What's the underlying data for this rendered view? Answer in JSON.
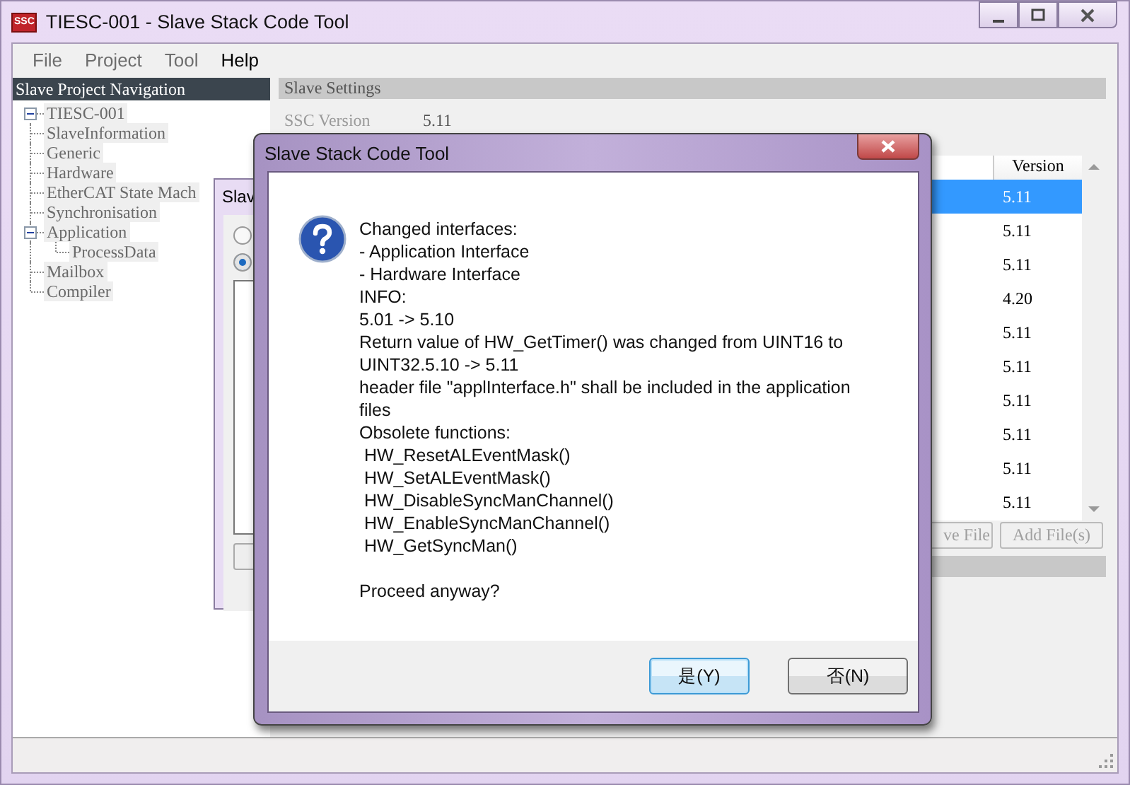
{
  "window": {
    "title": "TIESC-001 - Slave Stack Code Tool",
    "app_icon": "SSC"
  },
  "menu": [
    {
      "label": "File",
      "disabled": true
    },
    {
      "label": "Project",
      "disabled": true
    },
    {
      "label": "Tool",
      "disabled": true
    },
    {
      "label": "Help",
      "disabled": false
    }
  ],
  "navigation": {
    "title": "Slave Project Navigation",
    "tree": [
      {
        "label": "TIESC-001",
        "expanded": true,
        "children": [
          {
            "label": "SlaveInformation"
          },
          {
            "label": "Generic"
          },
          {
            "label": "Hardware"
          },
          {
            "label": "EtherCAT State Mach"
          },
          {
            "label": "Synchronisation"
          },
          {
            "label": "Application",
            "expanded": true,
            "children": [
              {
                "label": "ProcessData"
              }
            ]
          },
          {
            "label": "Mailbox"
          },
          {
            "label": "Compiler"
          }
        ]
      }
    ]
  },
  "settings": {
    "title": "Slave Settings",
    "fields": [
      {
        "label": "SSC Version",
        "value": "5.11"
      }
    ],
    "table": {
      "columns": [
        "Version"
      ],
      "rows": [
        {
          "version": "5.11",
          "selected": true
        },
        {
          "version": "5.11",
          "selected": false
        },
        {
          "version": "5.11",
          "selected": false
        },
        {
          "version": "4.20",
          "selected": false
        },
        {
          "version": "5.11",
          "selected": false
        },
        {
          "version": "5.11",
          "selected": false
        },
        {
          "version": "5.11",
          "selected": false
        },
        {
          "version": "5.11",
          "selected": false
        },
        {
          "version": "5.11",
          "selected": false
        },
        {
          "version": "5.11",
          "selected": false
        }
      ]
    },
    "buttons": [
      "ve File",
      "Add File(s)"
    ]
  },
  "background_dialog": {
    "title": "Slav",
    "options": [
      {
        "selected": false
      },
      {
        "selected": true
      }
    ]
  },
  "dialog": {
    "title": "Slave Stack Code Tool",
    "message_lines": [
      "Changed interfaces:",
      "- Application Interface",
      "- Hardware Interface",
      "INFO:",
      "5.01 -> 5.10",
      "Return value of HW_GetTimer() was changed from UINT16 to",
      "UINT32.5.10 -> 5.11",
      "header file \"applInterface.h\" shall be included in the application",
      "files",
      "Obsolete functions:",
      " HW_ResetALEventMask()",
      " HW_SetALEventMask()",
      " HW_DisableSyncManChannel()",
      " HW_EnableSyncManChannel()",
      " HW_GetSyncMan()"
    ],
    "question": "Proceed anyway?",
    "buttons": [
      {
        "label": "是(Y)",
        "focused": true
      },
      {
        "label": "否(N)",
        "focused": false
      }
    ]
  }
}
